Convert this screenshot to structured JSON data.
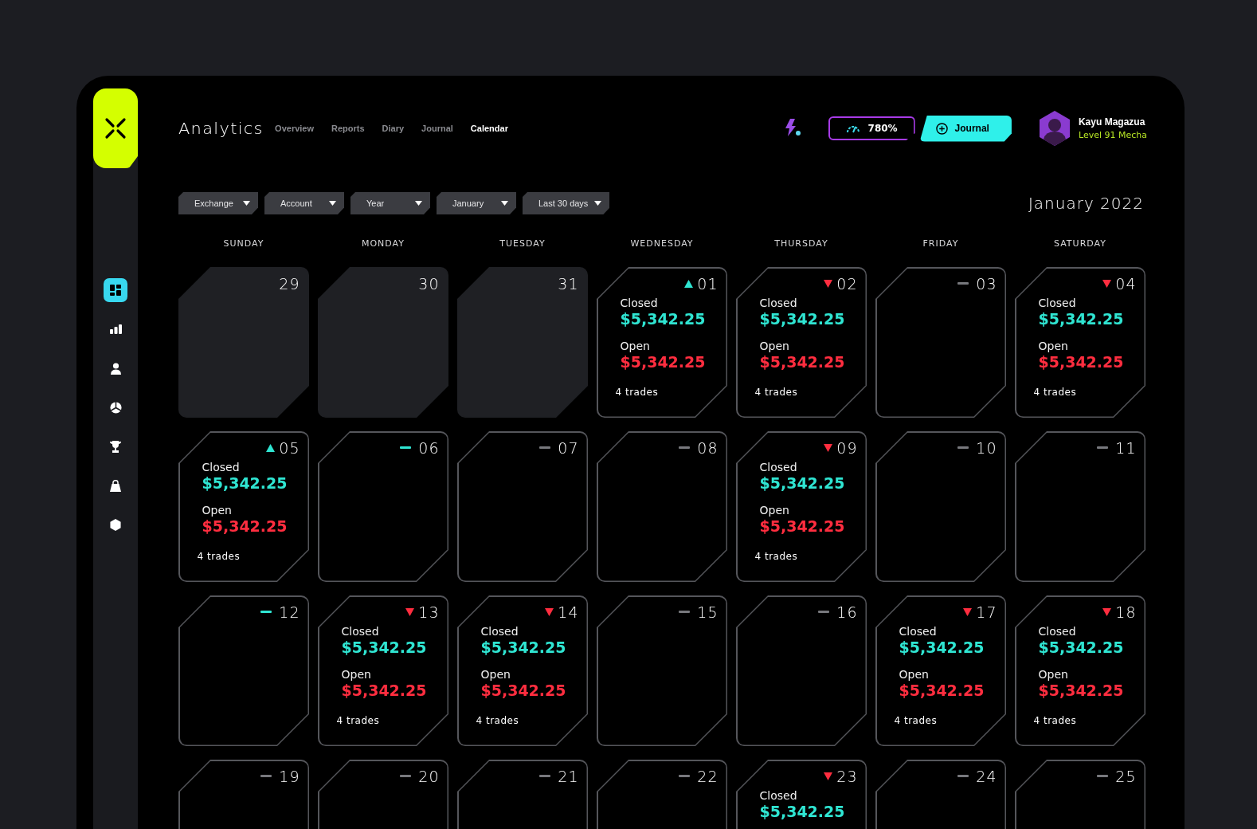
{
  "sidebar": {
    "items": [
      {
        "kind": "grid",
        "selected": true
      },
      {
        "kind": "bars",
        "selected": false
      },
      {
        "kind": "user",
        "selected": false
      },
      {
        "kind": "pie",
        "selected": false
      },
      {
        "kind": "trophy",
        "selected": false
      },
      {
        "kind": "bag",
        "selected": false
      },
      {
        "kind": "hexagon",
        "selected": false
      }
    ]
  },
  "header": {
    "title": "Analytics",
    "tabs": [
      {
        "label": "Overview",
        "selected": false
      },
      {
        "label": "Reports",
        "selected": false
      },
      {
        "label": "Diary",
        "selected": false
      },
      {
        "label": "Journal",
        "selected": false
      },
      {
        "label": "Calendar",
        "selected": true
      }
    ],
    "stat_chip": "780%",
    "journal_button": "Journal",
    "user": {
      "name": "Kayu Magazua",
      "level": "Level 91 Mecha"
    }
  },
  "filters": [
    "Exchange",
    "Account",
    "Year",
    "January",
    "Last 30 days"
  ],
  "month_title": "January 2022",
  "weekdays": [
    "SUNDAY",
    "MONDAY",
    "TUESDAY",
    "WEDNESDAY",
    "THURSDAY",
    "FRIDAY",
    "SATURDAY"
  ],
  "weeks": [
    [
      {
        "day": "29",
        "kind": "past"
      },
      {
        "day": "30",
        "kind": "past"
      },
      {
        "day": "31",
        "kind": "past"
      },
      {
        "day": "01",
        "kind": "up",
        "closed_label": "Closed",
        "closed": "$5,342.25",
        "open_label": "Open",
        "open": "$5,342.25",
        "trades": "4 trades"
      },
      {
        "day": "02",
        "kind": "down",
        "closed_label": "Closed",
        "closed": "$5,342.25",
        "open_label": "Open",
        "open": "$5,342.25",
        "trades": "4 trades"
      },
      {
        "day": "03",
        "kind": "flat"
      },
      {
        "day": "04",
        "kind": "down",
        "closed_label": "Closed",
        "closed": "$5,342.25",
        "open_label": "Open",
        "open": "$5,342.25",
        "trades": "4 trades"
      }
    ],
    [
      {
        "day": "05",
        "kind": "up",
        "closed_label": "Closed",
        "closed": "$5,342.25",
        "open_label": "Open",
        "open": "$5,342.25",
        "trades": "4 trades"
      },
      {
        "day": "06",
        "kind": "even"
      },
      {
        "day": "07",
        "kind": "flat"
      },
      {
        "day": "08",
        "kind": "flat"
      },
      {
        "day": "09",
        "kind": "down",
        "closed_label": "Closed",
        "closed": "$5,342.25",
        "open_label": "Open",
        "open": "$5,342.25",
        "trades": "4 trades"
      },
      {
        "day": "10",
        "kind": "flat"
      },
      {
        "day": "11",
        "kind": "flat"
      }
    ],
    [
      {
        "day": "12",
        "kind": "even"
      },
      {
        "day": "13",
        "kind": "down",
        "closed_label": "Closed",
        "closed": "$5,342.25",
        "open_label": "Open",
        "open": "$5,342.25",
        "trades": "4 trades"
      },
      {
        "day": "14",
        "kind": "down",
        "closed_label": "Closed",
        "closed": "$5,342.25",
        "open_label": "Open",
        "open": "$5,342.25",
        "trades": "4 trades"
      },
      {
        "day": "15",
        "kind": "flat"
      },
      {
        "day": "16",
        "kind": "flat"
      },
      {
        "day": "17",
        "kind": "down",
        "closed_label": "Closed",
        "closed": "$5,342.25",
        "open_label": "Open",
        "open": "$5,342.25",
        "trades": "4 trades"
      },
      {
        "day": "18",
        "kind": "down",
        "closed_label": "Closed",
        "closed": "$5,342.25",
        "open_label": "Open",
        "open": "$5,342.25",
        "trades": "4 trades"
      }
    ],
    [
      {
        "day": "19",
        "kind": "flat"
      },
      {
        "day": "20",
        "kind": "flat"
      },
      {
        "day": "21",
        "kind": "flat"
      },
      {
        "day": "22",
        "kind": "flat"
      },
      {
        "day": "23",
        "kind": "down",
        "closed_label": "Closed",
        "closed": "$5,342.25"
      },
      {
        "day": "24",
        "kind": "flat"
      },
      {
        "day": "25",
        "kind": "flat"
      }
    ]
  ]
}
